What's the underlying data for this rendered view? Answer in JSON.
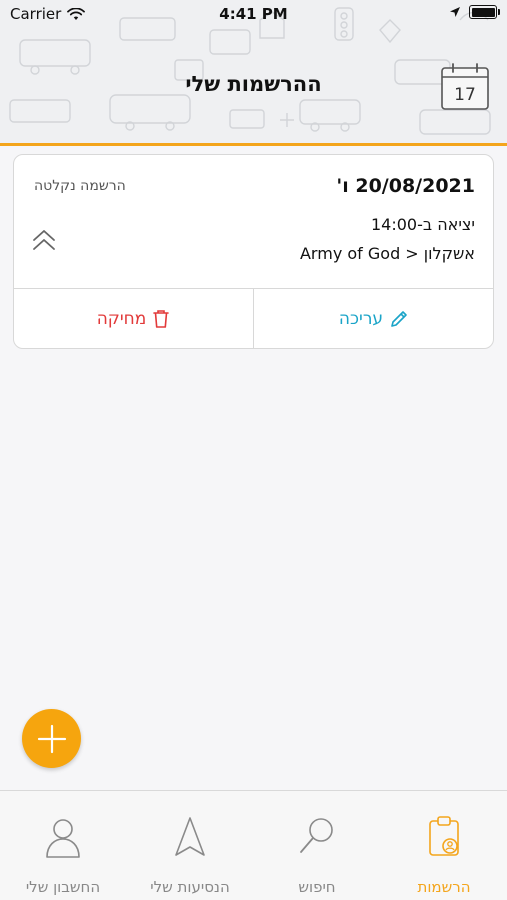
{
  "status_bar": {
    "carrier": "Carrier",
    "time": "4:41 PM"
  },
  "header": {
    "title": "ההרשמות שלי",
    "calendar_day": "17"
  },
  "registration": {
    "date": "20/08/2021 ו'",
    "status": "הרשמה נקלטה",
    "departure": "יציאה ב-14:00",
    "route": "אשקלון < Army of God",
    "edit_label": "עריכה",
    "delete_label": "מחיקה"
  },
  "tabs": [
    {
      "label": "החשבון שלי",
      "icon": "person-icon",
      "active": false
    },
    {
      "label": "הנסיעות שלי",
      "icon": "navigation-arrow-icon",
      "active": false
    },
    {
      "label": "חיפוש",
      "icon": "search-icon",
      "active": false
    },
    {
      "label": "הרשמות",
      "icon": "clipboard-user-icon",
      "active": true
    }
  ],
  "colors": {
    "accent": "#f4a51c",
    "edit": "#1aa4c8",
    "delete": "#e23a3a",
    "fab": "#f6a50e"
  }
}
